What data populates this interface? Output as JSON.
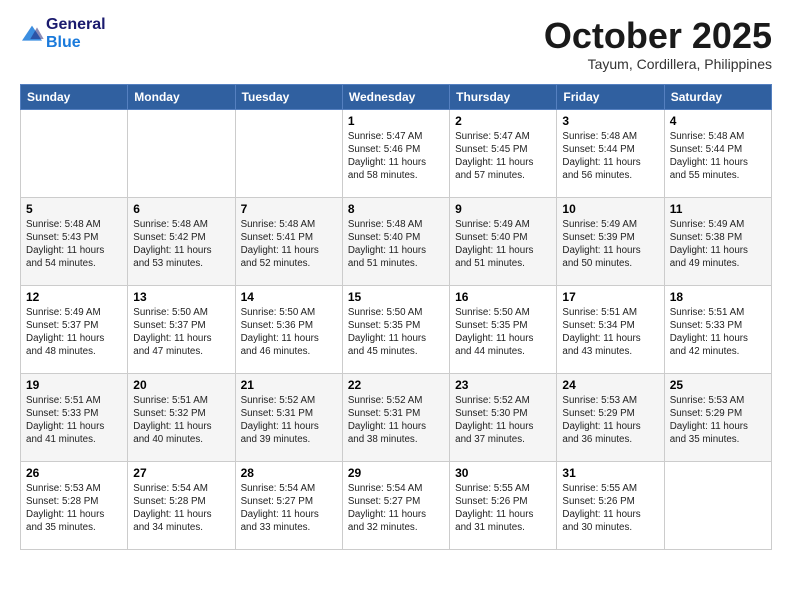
{
  "header": {
    "logo_line1": "General",
    "logo_line2": "Blue",
    "month": "October 2025",
    "location": "Tayum, Cordillera, Philippines"
  },
  "weekdays": [
    "Sunday",
    "Monday",
    "Tuesday",
    "Wednesday",
    "Thursday",
    "Friday",
    "Saturday"
  ],
  "weeks": [
    [
      {
        "day": "",
        "text": ""
      },
      {
        "day": "",
        "text": ""
      },
      {
        "day": "",
        "text": ""
      },
      {
        "day": "1",
        "text": "Sunrise: 5:47 AM\nSunset: 5:46 PM\nDaylight: 11 hours and 58 minutes."
      },
      {
        "day": "2",
        "text": "Sunrise: 5:47 AM\nSunset: 5:45 PM\nDaylight: 11 hours and 57 minutes."
      },
      {
        "day": "3",
        "text": "Sunrise: 5:48 AM\nSunset: 5:44 PM\nDaylight: 11 hours and 56 minutes."
      },
      {
        "day": "4",
        "text": "Sunrise: 5:48 AM\nSunset: 5:44 PM\nDaylight: 11 hours and 55 minutes."
      }
    ],
    [
      {
        "day": "5",
        "text": "Sunrise: 5:48 AM\nSunset: 5:43 PM\nDaylight: 11 hours and 54 minutes."
      },
      {
        "day": "6",
        "text": "Sunrise: 5:48 AM\nSunset: 5:42 PM\nDaylight: 11 hours and 53 minutes."
      },
      {
        "day": "7",
        "text": "Sunrise: 5:48 AM\nSunset: 5:41 PM\nDaylight: 11 hours and 52 minutes."
      },
      {
        "day": "8",
        "text": "Sunrise: 5:48 AM\nSunset: 5:40 PM\nDaylight: 11 hours and 51 minutes."
      },
      {
        "day": "9",
        "text": "Sunrise: 5:49 AM\nSunset: 5:40 PM\nDaylight: 11 hours and 51 minutes."
      },
      {
        "day": "10",
        "text": "Sunrise: 5:49 AM\nSunset: 5:39 PM\nDaylight: 11 hours and 50 minutes."
      },
      {
        "day": "11",
        "text": "Sunrise: 5:49 AM\nSunset: 5:38 PM\nDaylight: 11 hours and 49 minutes."
      }
    ],
    [
      {
        "day": "12",
        "text": "Sunrise: 5:49 AM\nSunset: 5:37 PM\nDaylight: 11 hours and 48 minutes."
      },
      {
        "day": "13",
        "text": "Sunrise: 5:50 AM\nSunset: 5:37 PM\nDaylight: 11 hours and 47 minutes."
      },
      {
        "day": "14",
        "text": "Sunrise: 5:50 AM\nSunset: 5:36 PM\nDaylight: 11 hours and 46 minutes."
      },
      {
        "day": "15",
        "text": "Sunrise: 5:50 AM\nSunset: 5:35 PM\nDaylight: 11 hours and 45 minutes."
      },
      {
        "day": "16",
        "text": "Sunrise: 5:50 AM\nSunset: 5:35 PM\nDaylight: 11 hours and 44 minutes."
      },
      {
        "day": "17",
        "text": "Sunrise: 5:51 AM\nSunset: 5:34 PM\nDaylight: 11 hours and 43 minutes."
      },
      {
        "day": "18",
        "text": "Sunrise: 5:51 AM\nSunset: 5:33 PM\nDaylight: 11 hours and 42 minutes."
      }
    ],
    [
      {
        "day": "19",
        "text": "Sunrise: 5:51 AM\nSunset: 5:33 PM\nDaylight: 11 hours and 41 minutes."
      },
      {
        "day": "20",
        "text": "Sunrise: 5:51 AM\nSunset: 5:32 PM\nDaylight: 11 hours and 40 minutes."
      },
      {
        "day": "21",
        "text": "Sunrise: 5:52 AM\nSunset: 5:31 PM\nDaylight: 11 hours and 39 minutes."
      },
      {
        "day": "22",
        "text": "Sunrise: 5:52 AM\nSunset: 5:31 PM\nDaylight: 11 hours and 38 minutes."
      },
      {
        "day": "23",
        "text": "Sunrise: 5:52 AM\nSunset: 5:30 PM\nDaylight: 11 hours and 37 minutes."
      },
      {
        "day": "24",
        "text": "Sunrise: 5:53 AM\nSunset: 5:29 PM\nDaylight: 11 hours and 36 minutes."
      },
      {
        "day": "25",
        "text": "Sunrise: 5:53 AM\nSunset: 5:29 PM\nDaylight: 11 hours and 35 minutes."
      }
    ],
    [
      {
        "day": "26",
        "text": "Sunrise: 5:53 AM\nSunset: 5:28 PM\nDaylight: 11 hours and 35 minutes."
      },
      {
        "day": "27",
        "text": "Sunrise: 5:54 AM\nSunset: 5:28 PM\nDaylight: 11 hours and 34 minutes."
      },
      {
        "day": "28",
        "text": "Sunrise: 5:54 AM\nSunset: 5:27 PM\nDaylight: 11 hours and 33 minutes."
      },
      {
        "day": "29",
        "text": "Sunrise: 5:54 AM\nSunset: 5:27 PM\nDaylight: 11 hours and 32 minutes."
      },
      {
        "day": "30",
        "text": "Sunrise: 5:55 AM\nSunset: 5:26 PM\nDaylight: 11 hours and 31 minutes."
      },
      {
        "day": "31",
        "text": "Sunrise: 5:55 AM\nSunset: 5:26 PM\nDaylight: 11 hours and 30 minutes."
      },
      {
        "day": "",
        "text": ""
      }
    ]
  ]
}
